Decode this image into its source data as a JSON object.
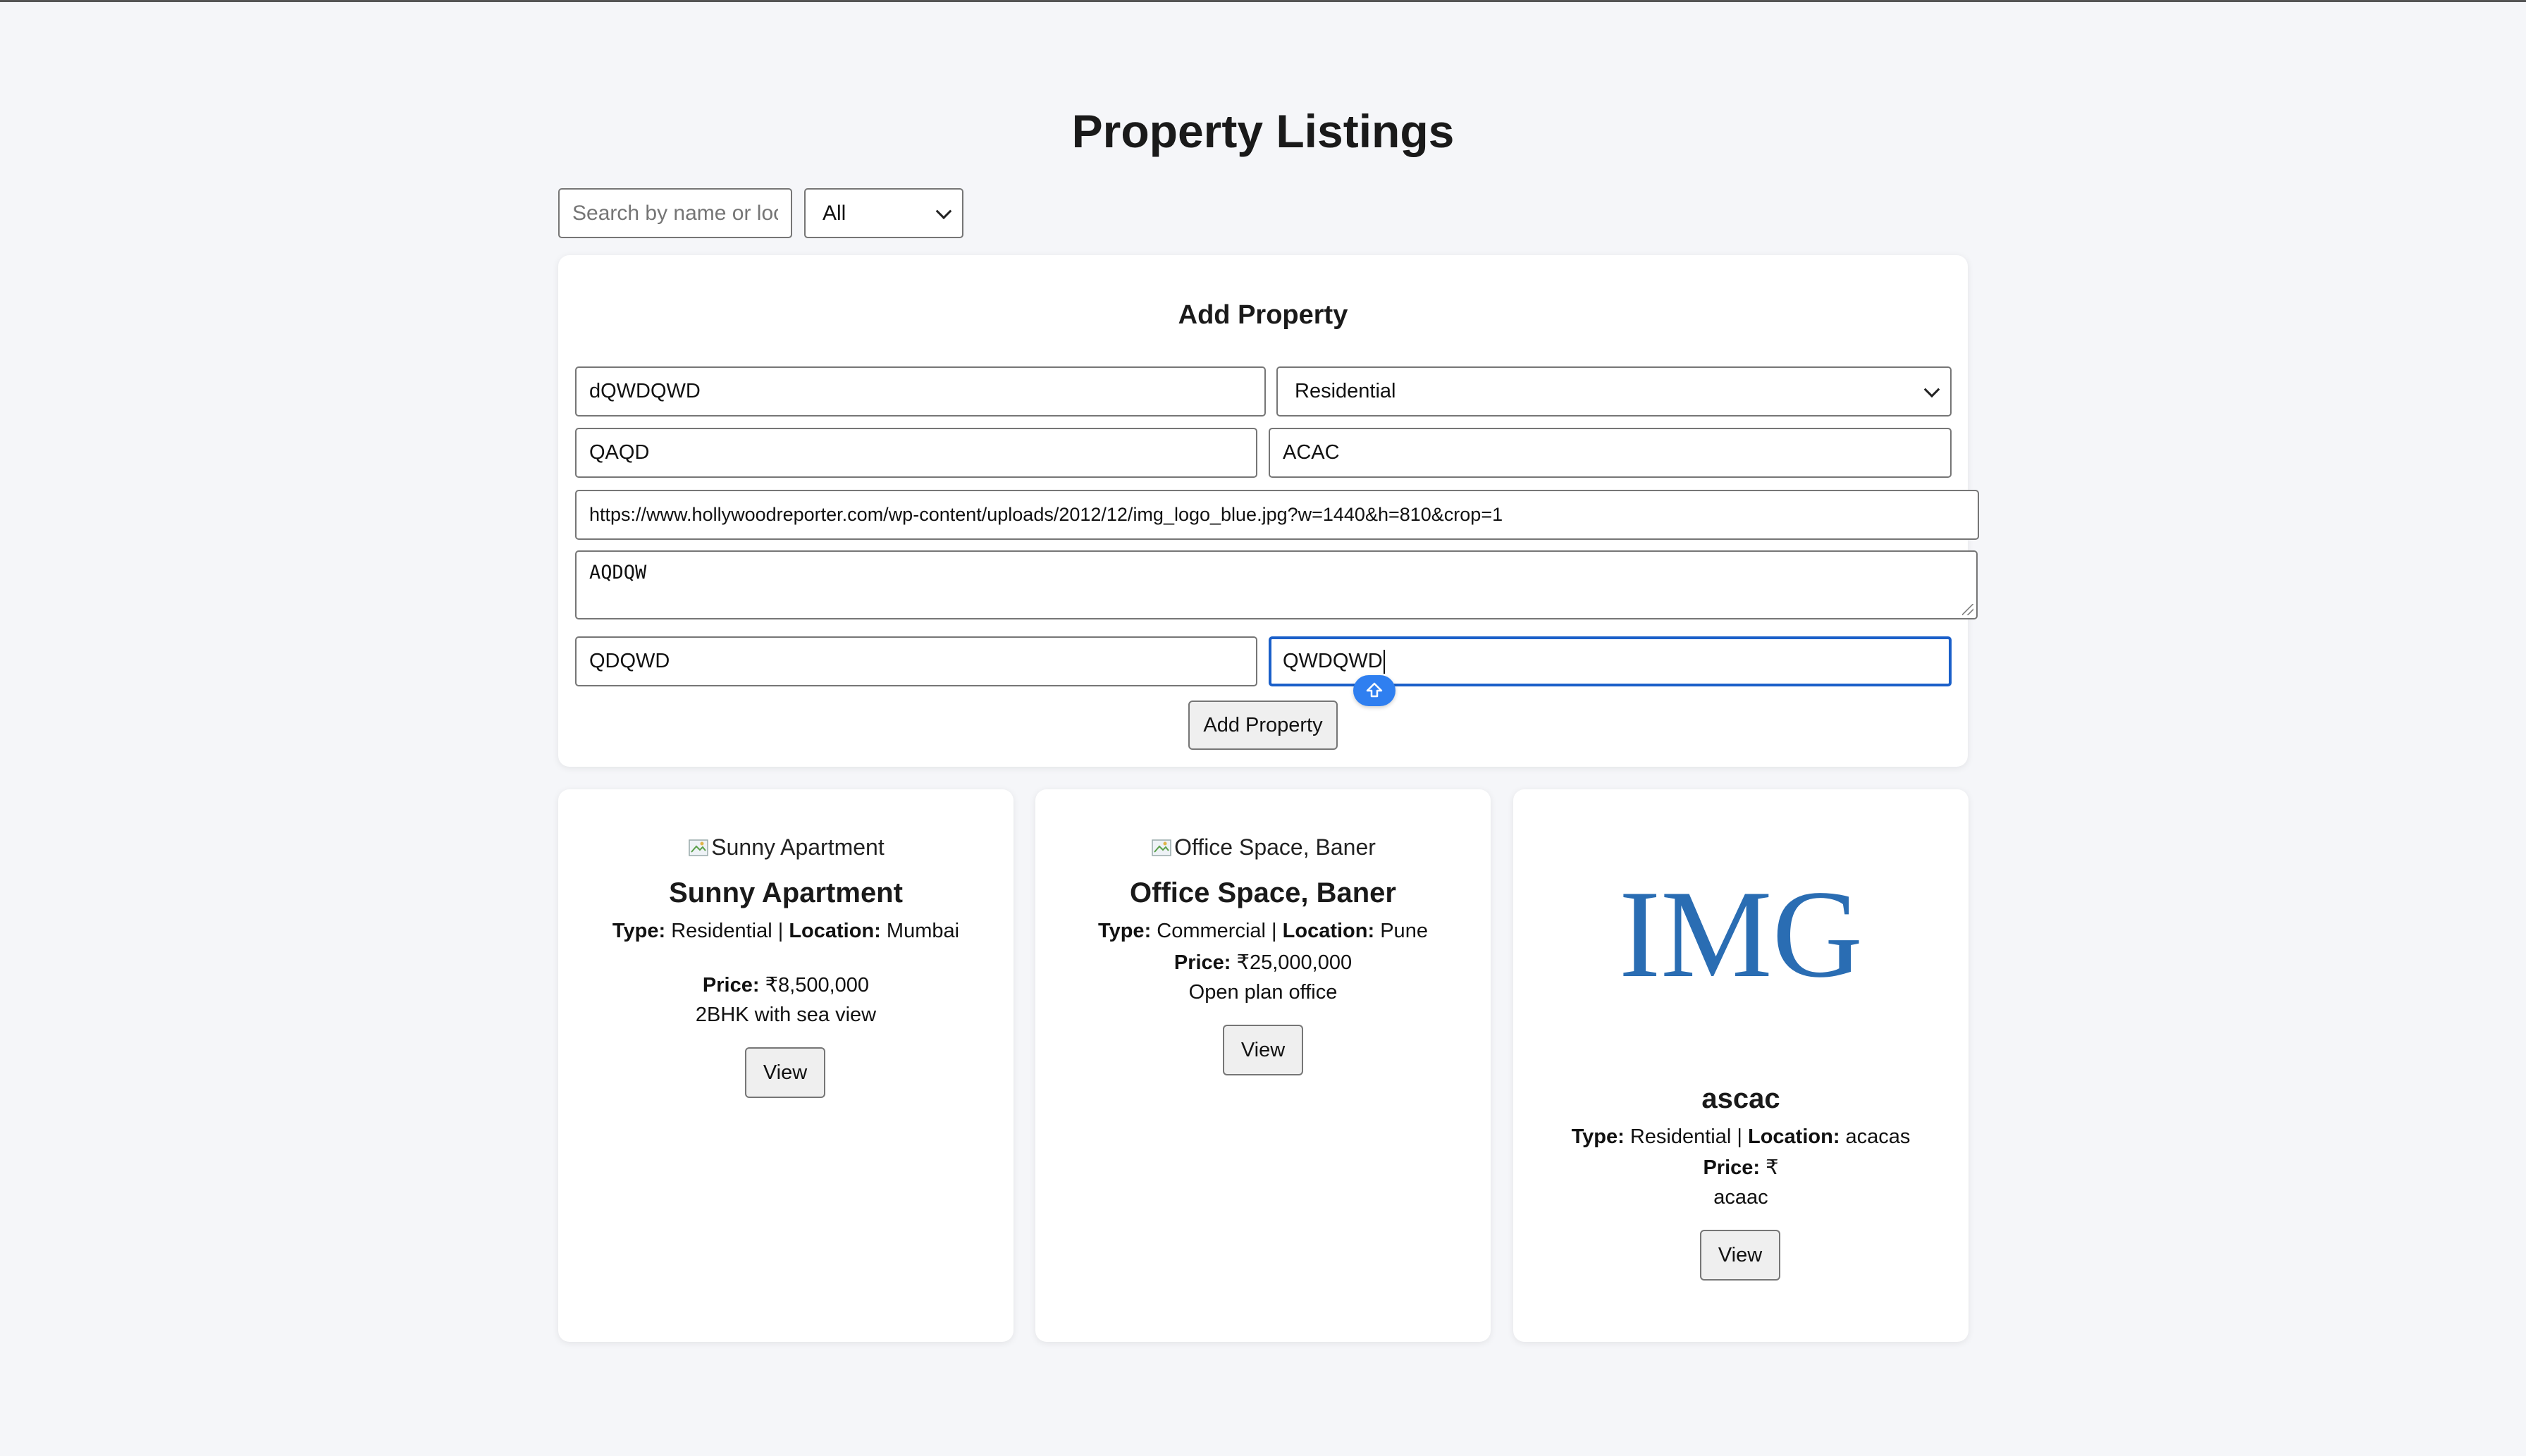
{
  "page": {
    "title": "Property Listings"
  },
  "filters": {
    "search_placeholder": "Search by name or location",
    "type_filter_value": "All"
  },
  "add_form": {
    "title": "Add Property",
    "name_value": "dQWDQWD",
    "type_value": "Residential",
    "location_value": "QAQD",
    "price_value": "ACAC",
    "image_url_value": "https://www.hollywoodreporter.com/wp-content/uploads/2012/12/img_logo_blue.jpg?w=1440&h=810&crop=1",
    "description_value": "AQDQW",
    "field7_value": "QDQWD",
    "field8_value": "QWDQWD",
    "submit_label": "Add Property"
  },
  "labels": {
    "type": "Type:",
    "location": "Location:",
    "price": "Price:",
    "separator": "|",
    "view": "View"
  },
  "properties": [
    {
      "image_alt": "Sunny Apartment",
      "name": "Sunny Apartment",
      "type": "Residential",
      "location": "Mumbai",
      "price": "₹8,500,000",
      "description": "2BHK with sea view"
    },
    {
      "image_alt": "Office Space, Baner",
      "name": "Office Space, Baner",
      "type": "Commercial",
      "location": "Pune",
      "price": "₹25,000,000",
      "description": "Open plan office"
    },
    {
      "image_text": "IMG",
      "name": "ascac",
      "type": "Residential",
      "location": "acacas",
      "price": "₹",
      "description": "acaac"
    }
  ],
  "colors": {
    "page_bg": "#f5f6f9",
    "focus_ring": "#1a5fc9",
    "logo_blue": "#2a6db3",
    "badge_blue": "#2f7ff0"
  }
}
